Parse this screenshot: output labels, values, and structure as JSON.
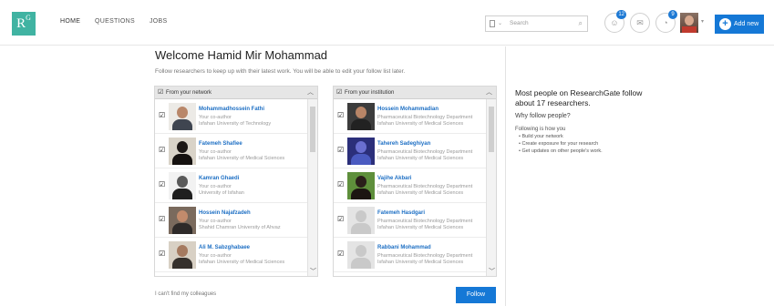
{
  "nav": {
    "logo_text": "R",
    "logo_sup": "G",
    "home": "HOME",
    "questions": "QUESTIONS",
    "jobs": "JOBS",
    "search_placeholder": "Search",
    "badge_1": "12",
    "badge_2": "9",
    "add_new": "Add new"
  },
  "main": {
    "welcome": "Welcome Hamid Mir Mohammad",
    "subtext": "Follow researchers to keep up with their latest work. You will be able to edit your follow list later.",
    "left_header": "From your network",
    "right_header": "From your institution",
    "cant_find": "I can't find my colleagues",
    "follow_button": "Follow"
  },
  "left_list": [
    {
      "name": "Mohammadhossein Fathi",
      "line2": "Your co-author",
      "line3": "Isfahan University of Technology"
    },
    {
      "name": "Fatemeh Shafiee",
      "line2": "Your co-author",
      "line3": "Isfahan University of Medical Sciences"
    },
    {
      "name": "Kamran Ghaedi",
      "line2": "Your co-author",
      "line3": "University of Isfahan"
    },
    {
      "name": "Hossein Najafzadeh",
      "line2": "Your co-author",
      "line3": "Shahid Chamran University of Ahvaz"
    },
    {
      "name": "Ali M. Sabzghabaee",
      "line2": "Your co-author",
      "line3": "Isfahan University of Medical Sciences"
    }
  ],
  "right_list": [
    {
      "name": "Hossein Mohammadian",
      "line2": "Pharmaceutical Biotechnology Department",
      "line3": "Isfahan University of Medical Sciences"
    },
    {
      "name": "Tahereh Sadeghiyan",
      "line2": "Pharmaceutical Biotechnology Department",
      "line3": "Isfahan University of Medical Sciences"
    },
    {
      "name": "Vajihe Akbari",
      "line2": "Pharmaceutical Biotechnology Department",
      "line3": "Isfahan University of Medical Sciences"
    },
    {
      "name": "Fatemeh Hasdgari",
      "line2": "Pharmaceutical Biotechnology Department",
      "line3": "Isfahan University of Medical Sciences"
    },
    {
      "name": "Rabbani Mohammad",
      "line2": "Pharmaceutical Biotechnology Department",
      "line3": "Isfahan University of Medical Sciences"
    }
  ],
  "info": {
    "title": "Most people on ResearchGate follow about 17 researchers.",
    "why": "Why follow people?",
    "helps": "Following is how you",
    "bullets": [
      "Build your network",
      "Create exposure for your research",
      "Get updates on other people's work."
    ]
  }
}
